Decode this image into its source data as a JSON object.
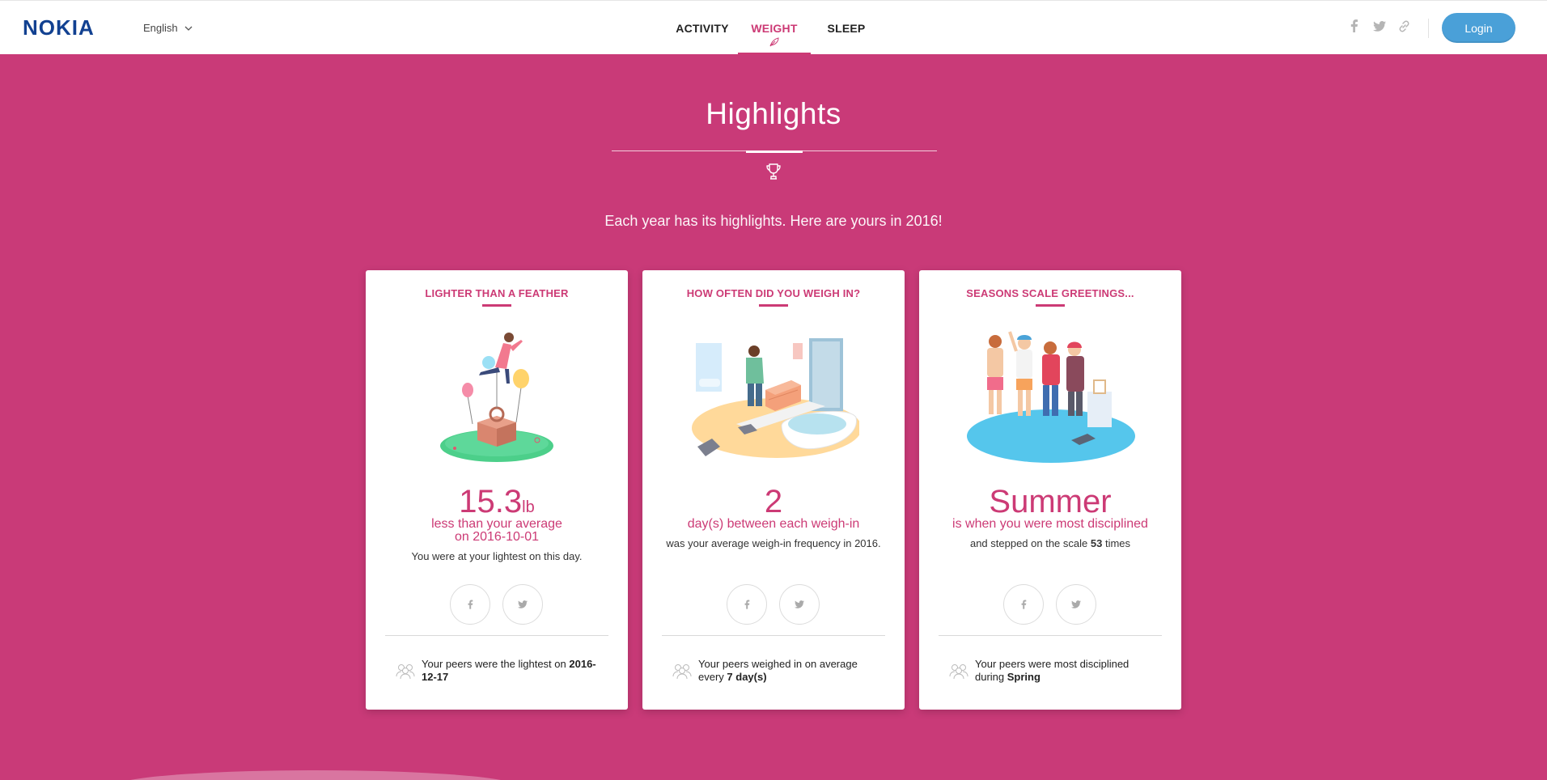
{
  "brand": {
    "logo_text": "NOKIA",
    "color": "#124191"
  },
  "header": {
    "language": "English",
    "nav": [
      {
        "label": "ACTIVITY",
        "active": false
      },
      {
        "label": "WEIGHT",
        "active": true
      },
      {
        "label": "SLEEP",
        "active": false
      }
    ],
    "social_icons": [
      "facebook-icon",
      "twitter-icon",
      "link-icon"
    ],
    "login_label": "Login"
  },
  "hero": {
    "title": "Highlights",
    "subtitle": "Each year has its highlights. Here are yours in 2016!"
  },
  "cards": [
    {
      "title": "LIGHTER THAN A FEATHER",
      "value": "15.3",
      "unit": "lb",
      "line1": "less than your average",
      "line2": "on 2016-10-01",
      "description": "You were at your lightest on this day.",
      "peers_text": "Your peers were the lightest on",
      "peers_value": "2016-12-17"
    },
    {
      "title": "HOW OFTEN DID YOU WEIGH IN?",
      "value": "2",
      "line1": "day(s) between each weigh-in",
      "description": "was your average weigh-in frequency in 2016.",
      "peers_text": "Your peers weighed in on average every",
      "peers_value": "7 day(s)"
    },
    {
      "title": "SEASONS SCALE GREETINGS...",
      "value": "Summer",
      "line1": "is when you were most disciplined",
      "description_prefix": "and stepped on the scale",
      "description_count": "53",
      "description_suffix": "times",
      "peers_text": "Your peers were most disciplined during",
      "peers_value": "Spring"
    }
  ],
  "colors": {
    "accent": "#cc3a75",
    "background": "#c93a78",
    "login": "#4aa0d8"
  }
}
